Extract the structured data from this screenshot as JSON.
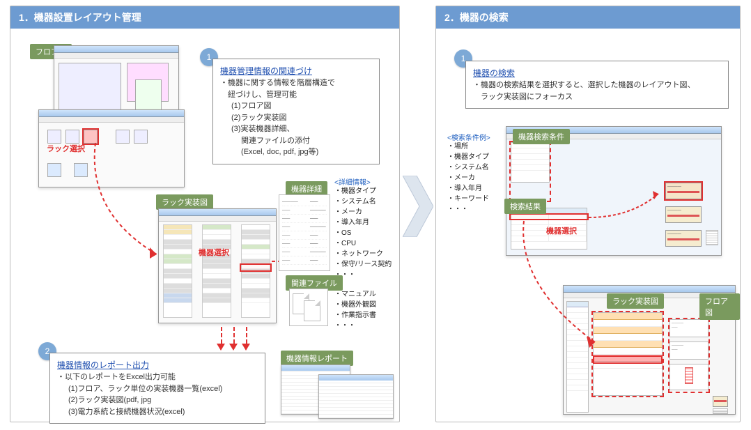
{
  "panel1": {
    "title": "1．機器設置レイアウト管理",
    "floor_label": "フロア図",
    "rack_select_label": "ラック選択",
    "rack_diagram_label": "ラック実装図",
    "device_select_label": "機器選択",
    "device_detail_label": "機器詳細",
    "related_files_label": "関連ファイル",
    "report_label": "機器情報レポート",
    "info1": {
      "title": "機器管理情報の関連づけ",
      "line1": "・機器に関する情報を階層構造で",
      "line2": "　紐づけし、管理可能",
      "sub1": "(1)フロア図",
      "sub2": "(2)ラック実装図",
      "sub3": "(3)実装機器詳細、",
      "sub4": "　 関連ファイルの添付",
      "sub5": "　 (Excel, doc, pdf, jpg等)"
    },
    "detail_header": "<詳細情報>",
    "detail_items": {
      "i1": "・機器タイプ",
      "i2": "・システム名",
      "i3": "・メーカ",
      "i4": "・導入年月",
      "i5": "・OS",
      "i6": "・CPU",
      "i7": "・ネットワーク",
      "i8": "・保守/リース契約",
      "i9": "・・・"
    },
    "related_items": {
      "r1": "・マニュアル",
      "r2": "・機器外観図",
      "r3": "・作業指示書",
      "r4": "・・・"
    },
    "info2": {
      "title": "機器情報のレポート出力",
      "line1": "・以下のレポートをExcel出力可能",
      "sub1": "(1)フロア、ラック単位の実装機器一覧(excel)",
      "sub2": "(2)ラック実装図(pdf, jpg",
      "sub3": "(3)電力系統と接続機器状況(excel)"
    },
    "badge1": "1",
    "badge2": "2"
  },
  "panel2": {
    "title": "2．機器の検索",
    "info": {
      "title": "機器の検索",
      "line1": "・機器の検索結果を選択すると、選択した機器のレイアウト図、",
      "line2": "　ラック実装図にフォーカス"
    },
    "badge1": "1",
    "cond_header": "<検索条件例>",
    "cond_items": {
      "c1": "・場所",
      "c2": "・機器タイプ",
      "c3": "・システム名",
      "c4": "・メーカ",
      "c5": "・導入年月",
      "c6": "・キーワード",
      "c7": "・・・"
    },
    "search_cond_label": "機器検索条件",
    "search_result_label": "検索結果",
    "device_select_label": "機器選択",
    "rack_diagram_label": "ラック実装図",
    "floor_label": "フロア図"
  }
}
